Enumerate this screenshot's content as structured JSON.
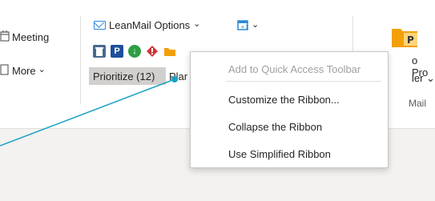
{
  "ribbon": {
    "meeting_label": "Meeting",
    "more_label": "More",
    "more_chevron": "⌄",
    "leanmail_label": "LeanMail Options",
    "leanmail_chevron": "⌄",
    "calendar_chevron": "⌄",
    "prioritize_label": "Prioritize (12)",
    "plan_label": "Plar",
    "pro_label_1": "o Pro",
    "pro_label_2": "ler ⌄",
    "mail_label": "Mail",
    "icons": [
      "delete-icon",
      "p-icon",
      "down-arrow-icon",
      "diamond-icon",
      "folder-icon",
      "calendar-plus-icon"
    ],
    "icon_colors": {
      "delete": "#486991",
      "p": "#1e4e9c",
      "down": "#2e9e44",
      "diamond": "#d13438",
      "folder": "#f2a007",
      "calendar": "#2b88d8"
    }
  },
  "context_menu": {
    "items": [
      {
        "label": "Add to Quick Access Toolbar",
        "enabled": false
      },
      {
        "label": "Customize the Ribbon...",
        "enabled": true
      },
      {
        "label": "Collapse the Ribbon",
        "enabled": true
      },
      {
        "label": "Use Simplified Ribbon",
        "enabled": true
      }
    ]
  },
  "pointer": {
    "color": "#1ba1c6"
  }
}
